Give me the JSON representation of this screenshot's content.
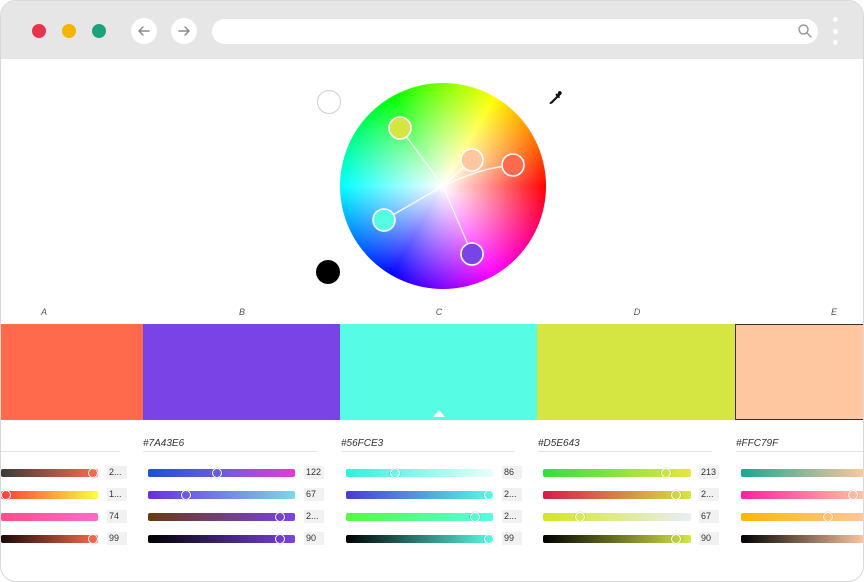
{
  "browser": {
    "address_value": "",
    "address_placeholder": ""
  },
  "colors": {
    "close_dot": "#e8334e",
    "minimize_dot": "#f4b400",
    "maximize_dot": "#1ba37d"
  },
  "icons": {
    "back": "arrow-left-icon",
    "forward": "arrow-right-icon",
    "search": "search-icon",
    "menu": "kebab-menu-icon",
    "picker": "eyedropper-icon"
  },
  "palette": {
    "selected": "C",
    "columns": [
      {
        "label": "A",
        "color": "#ff6a4d",
        "hex": "",
        "sliders": [
          {
            "value": "2...",
            "gradient": [
              "#3a3a3a",
              "#ff6a4d"
            ],
            "pos": 0.95
          },
          {
            "value": "1...",
            "gradient": [
              "#ff3a3a",
              "#ffff40"
            ],
            "pos": 0.05
          },
          {
            "value": "74",
            "gradient": [
              "#ff4d8a",
              "#ff6acd"
            ],
            "pos": null
          },
          {
            "value": "99",
            "gradient": [
              "#1a0a06",
              "#ff6a4d"
            ],
            "pos": 0.95
          }
        ]
      },
      {
        "label": "B",
        "color": "#7a43e6",
        "hex": "#7A43E6",
        "sliders": [
          {
            "value": "122",
            "gradient": [
              "#1c4fd8",
              "#6a5de0",
              "#e33ad8"
            ],
            "pos": 0.47
          },
          {
            "value": "67",
            "gradient": [
              "#6a2de0",
              "#7ad8e8"
            ],
            "pos": 0.26
          },
          {
            "value": "2...",
            "gradient": [
              "#6a3a10",
              "#7a43e6"
            ],
            "pos": 0.9
          },
          {
            "value": "90",
            "gradient": [
              "#000000",
              "#7a43e6"
            ],
            "pos": 0.9
          }
        ]
      },
      {
        "label": "C",
        "color": "#56fce3",
        "hex": "#56FCE3",
        "sliders": [
          {
            "value": "86",
            "gradient": [
              "#30f0e0",
              "#e8fff8"
            ],
            "pos": 0.33
          },
          {
            "value": "2...",
            "gradient": [
              "#4a3ad8",
              "#56fce3"
            ],
            "pos": 0.97
          },
          {
            "value": "2...",
            "gradient": [
              "#56fc40",
              "#56fce3"
            ],
            "pos": 0.88
          },
          {
            "value": "99",
            "gradient": [
              "#000000",
              "#56fce3"
            ],
            "pos": 0.97
          }
        ]
      },
      {
        "label": "D",
        "color": "#d5e643",
        "hex": "#D5E643",
        "sliders": [
          {
            "value": "213",
            "gradient": [
              "#30e040",
              "#e8e640"
            ],
            "pos": 0.83
          },
          {
            "value": "2...",
            "gradient": [
              "#d81a4a",
              "#d5e643"
            ],
            "pos": 0.9
          },
          {
            "value": "67",
            "gradient": [
              "#d5e620",
              "#e8eef8"
            ],
            "pos": 0.25
          },
          {
            "value": "90",
            "gradient": [
              "#000000",
              "#d5e643"
            ],
            "pos": 0.9
          }
        ]
      },
      {
        "label": "E",
        "color": "#ffc79f",
        "hex": "#FFC79F",
        "sliders": [
          {
            "value": "",
            "gradient": [
              "#1aa890",
              "#ffc79f"
            ],
            "pos": null
          },
          {
            "value": "",
            "gradient": [
              "#ff20a0",
              "#ffc79f"
            ],
            "pos": 0.9
          },
          {
            "value": "",
            "gradient": [
              "#ffb800",
              "#ffc79f"
            ],
            "pos": 0.7
          },
          {
            "value": "",
            "gradient": [
              "#000000",
              "#ffc79f"
            ],
            "pos": null
          }
        ]
      }
    ]
  }
}
